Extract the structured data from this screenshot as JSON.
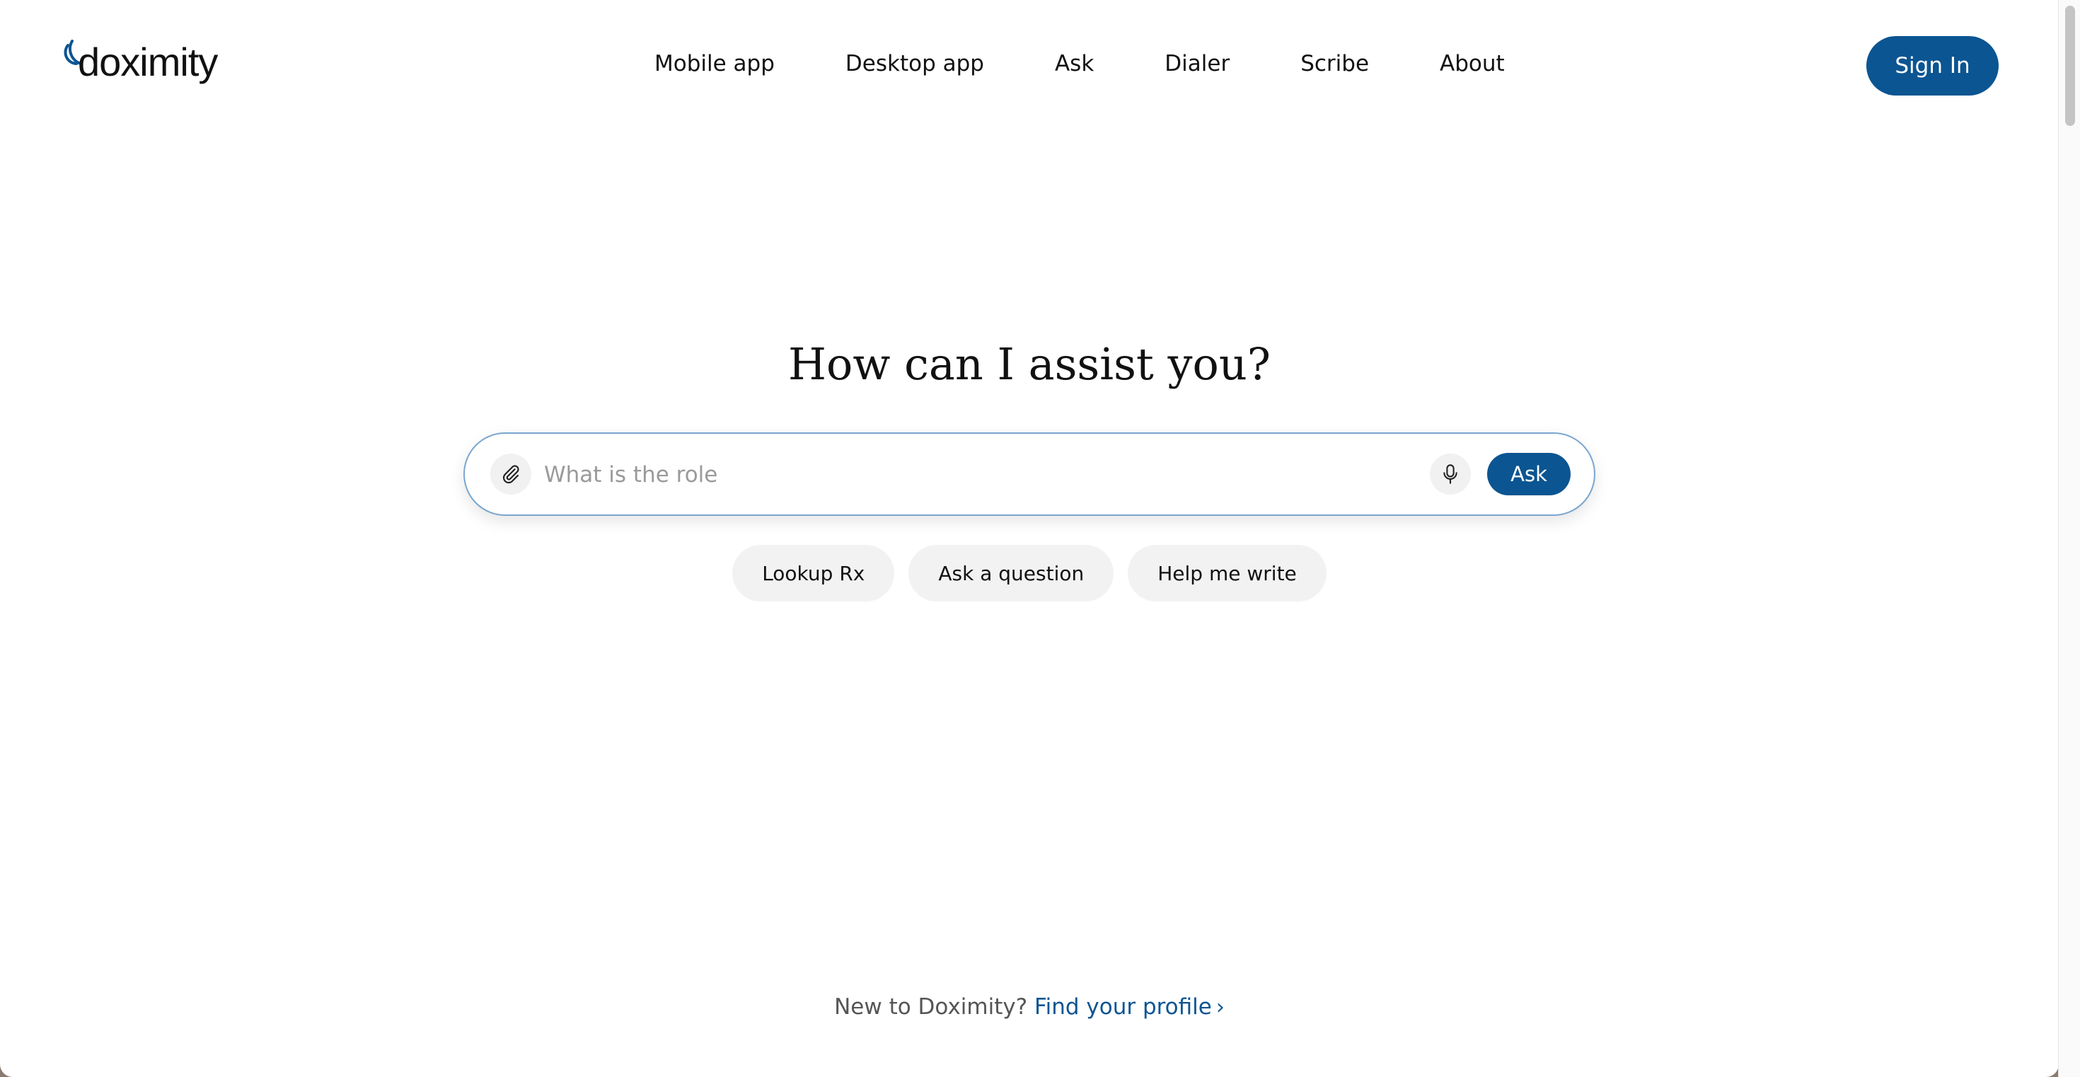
{
  "brand": {
    "logo_text": "doximity",
    "accent_color": "#0b5592"
  },
  "nav": {
    "items": [
      "Mobile app",
      "Desktop app",
      "Ask",
      "Dialer",
      "Scribe",
      "About"
    ]
  },
  "header": {
    "signin_label": "Sign In"
  },
  "hero": {
    "title": "How can I assist you?"
  },
  "search": {
    "placeholder": "What is the role",
    "value": "",
    "ask_label": "Ask",
    "attach_icon": "paperclip-icon",
    "mic_icon": "microphone-icon"
  },
  "chips": [
    "Lookup Rx",
    "Ask a question",
    "Help me write"
  ],
  "footer": {
    "prefix": "New to Doximity?",
    "link_label": "Find your profile",
    "chevron": "›"
  }
}
